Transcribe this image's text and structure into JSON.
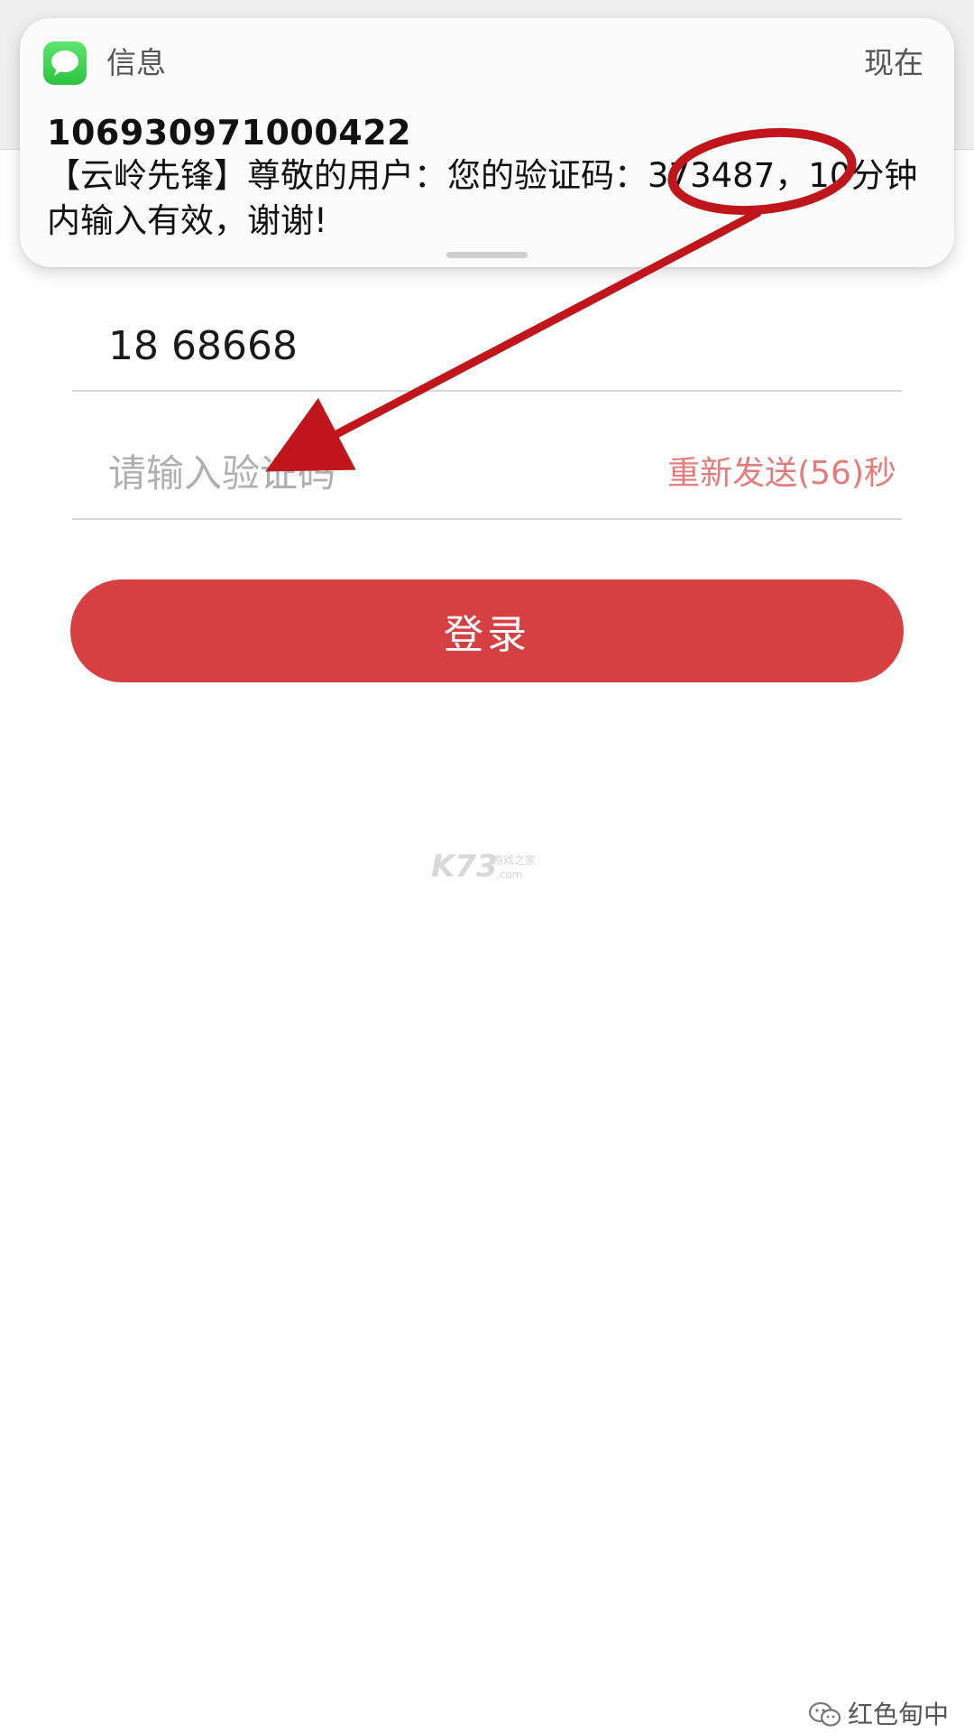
{
  "notification": {
    "app_name": "信息",
    "time": "现在",
    "sender": "106930971000422",
    "body": "【云岭先锋】尊敬的用户：您的验证码：373487，10分钟内输入有效，谢谢!"
  },
  "form": {
    "phone_value": "18      68668",
    "code_placeholder": "请输入验证码",
    "resend_label": "重新发送(56)秒",
    "login_label": "登录"
  },
  "watermarks": {
    "center_logo": "K73",
    "center_sub": "游戏之家",
    "center_domain": ".com",
    "wechat_account": "红色甸中"
  },
  "colors": {
    "brand_red": "#d64042",
    "resend_red": "#e57c7c",
    "annotation_red": "#c0161b",
    "messages_green": "#2bc43f"
  },
  "icons": {
    "app_icon": "messages-icon",
    "wechat_icon": "wechat-icon"
  }
}
